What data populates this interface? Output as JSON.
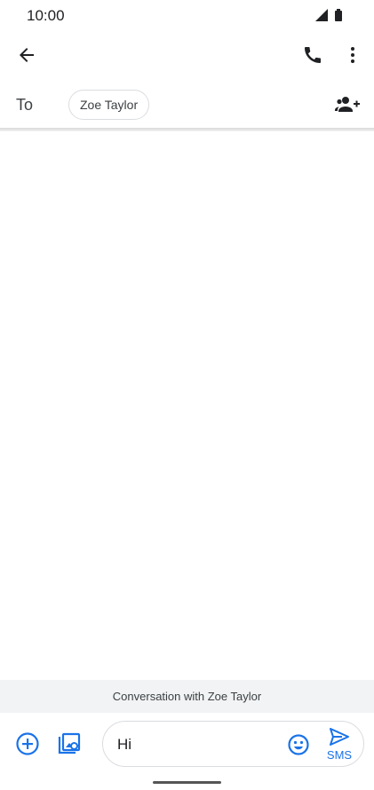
{
  "status_bar": {
    "time": "10:00",
    "icons": [
      "signal-icon",
      "battery-icon"
    ]
  },
  "app_bar": {
    "icons": [
      "back-arrow-icon",
      "phone-icon",
      "more-vert-icon"
    ]
  },
  "recipient": {
    "to_label": "To",
    "chip_name": "Zoe Taylor",
    "add_icon": "add-person-icon"
  },
  "conversation": {
    "banner_text": "Conversation with Zoe Taylor"
  },
  "compose": {
    "message_value": "Hi",
    "send_label": "SMS",
    "icons": [
      "add-circle-icon",
      "gallery-icon",
      "emoji-icon",
      "send-icon"
    ]
  },
  "colors": {
    "accent": "#1a73e8",
    "text_primary": "#202124",
    "banner_bg": "#f1f3f4"
  }
}
